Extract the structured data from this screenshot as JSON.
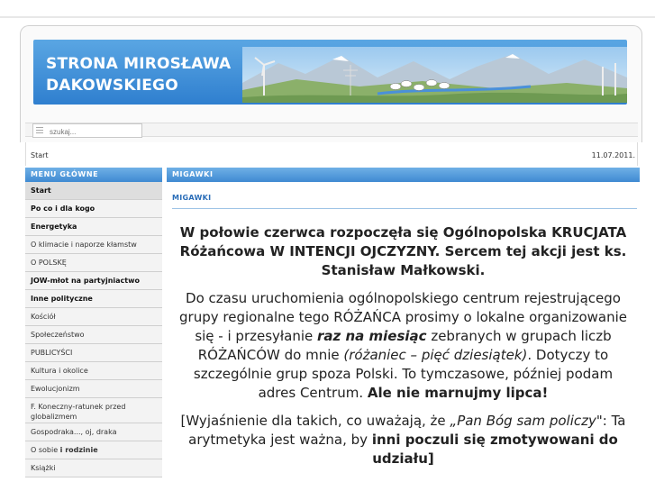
{
  "header": {
    "site_title_line1": "STRONA MIROSŁAWA",
    "site_title_line2": "DAKOWSKIEGO",
    "brand_color": "#3a88d6"
  },
  "search": {
    "placeholder": "szukaj..."
  },
  "breadcrumb": {
    "label": "Start"
  },
  "date": "11.07.2011.",
  "menu": {
    "title": "MENU GŁÓWNE",
    "items": [
      {
        "label": "Start"
      },
      {
        "label": "Po co i dla kogo"
      },
      {
        "label": "Energetyka"
      },
      {
        "label": "O klimacie i naporze kłamstw"
      },
      {
        "label": "O POLSKĘ"
      },
      {
        "label": "JOW-młot na partyjniactwo"
      },
      {
        "label": "Inne polityczne"
      },
      {
        "label": "Kościół"
      },
      {
        "label": "Społeczeństwo"
      },
      {
        "label": "PUBLICYŚCI"
      },
      {
        "label": "Kultura i okolice"
      },
      {
        "label": "Ewolucjonizm"
      },
      {
        "label": "F. Koneczny-ratunek przed globalizmem"
      },
      {
        "label": "Gospodraka..., oj, draka"
      },
      {
        "label_plain": "O sobie ",
        "label_bold": "i rodzinie"
      },
      {
        "label": "Książki"
      }
    ]
  },
  "content": {
    "section_title": "MIGAWKI",
    "article_title": "MIGAWKI",
    "lead": "W połowie czerwca rozpoczęła się Ogólnopolska KRUCJATA Różańcowa W INTENCJI OJCZYZNY. Sercem tej akcji jest ks. Stanisław Małkowski.",
    "para1_a": "Do czasu uruchomienia ogólnopolskiego centrum rejestrującego grupy regionalne tego RÓŻAŃCA prosimy o lokalne organizowanie się  - i przesyłanie ",
    "para1_b": "raz na miesiąc",
    "para1_c": " zebranych w grupach liczb RÓŻAŃCÓW do mnie ",
    "para1_d": "(różaniec – pięć dziesiątek)",
    "para1_e": ". Dotyczy to szczególnie grup spoza Polski. To tymczasowe, później podam adres Centrum. ",
    "para1_f": "Ale nie marnujmy lipca!",
    "para2_a": "[Wyjaśnienie dla takich, co uważają, że ",
    "para2_b": "„Pan Bóg sam policzy",
    "para2_c": "\": Ta arytmetyka jest ważna, by ",
    "para2_d": "inni poczuli się zmotywowani do udziału]"
  }
}
